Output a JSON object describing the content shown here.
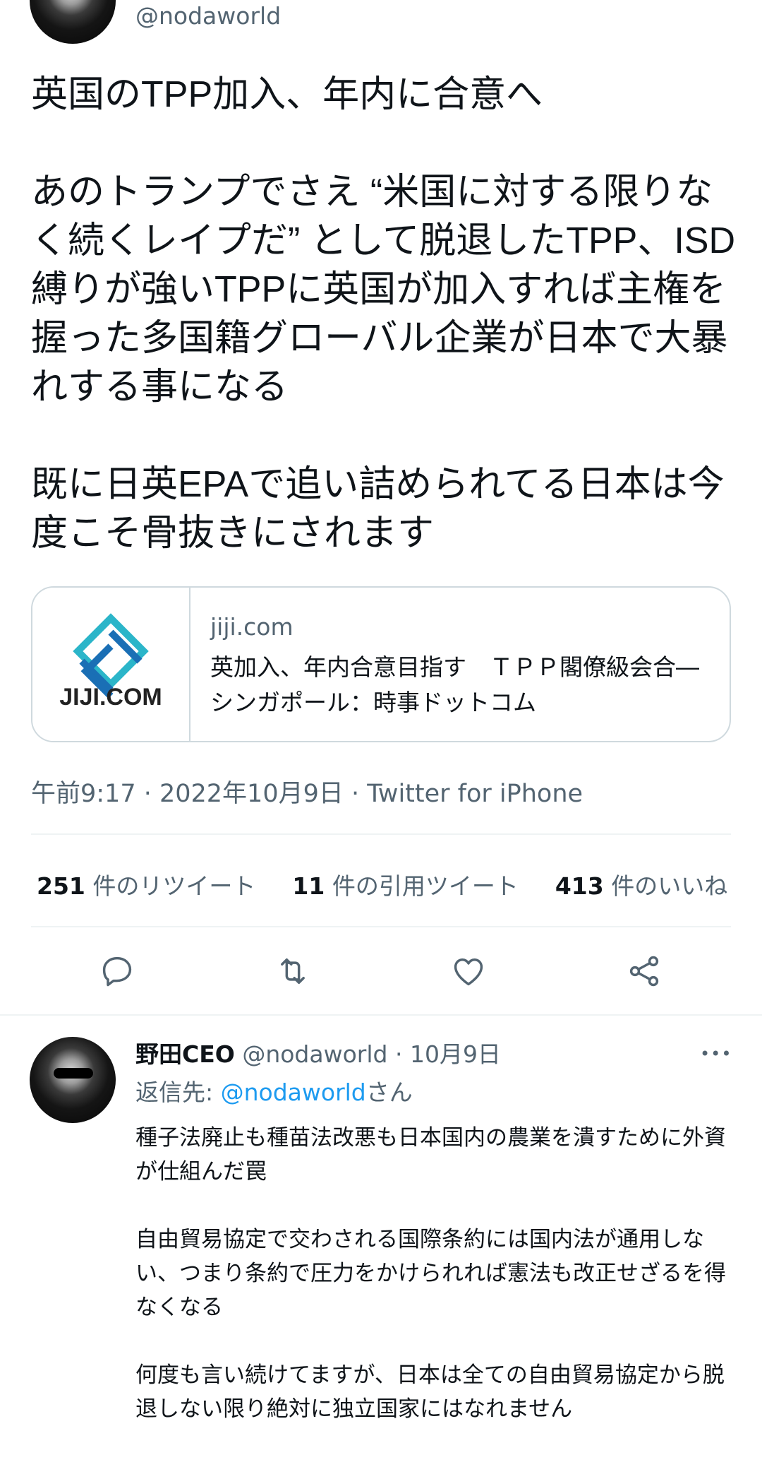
{
  "top_tweet": {
    "handle": "@nodaworld",
    "text": "英国のTPP加入、年内に合意へ\n\nあのトランプでさえ “米国に対する限りなく続くレイプだ” として脱退したTPP、ISD縛りが強いTPPに英国が加入すれば主権を握った多国籍グローバル企業が日本で大暴れする事になる\n\n既に日英EPAで追い詰められてる日本は今度こそ骨抜きにされます",
    "link_card": {
      "logo_text": "JIJI.COM",
      "domain": "jiji.com",
      "title": "英加入、年内合意目指す　ＴＰＰ閣僚級会合―シンガポール：時事ドットコム"
    },
    "meta": "午前9:17 · 2022年10月9日 · Twitter for iPhone",
    "stats": {
      "retweets": {
        "count": "251",
        "label": "件のリツイート"
      },
      "quotes": {
        "count": "11",
        "label": "件の引用ツイート"
      },
      "likes": {
        "count": "413",
        "label": "件のいいね"
      }
    },
    "actions": [
      "reply-icon",
      "retweet-icon",
      "like-icon",
      "share-icon"
    ]
  },
  "reply": {
    "name": "野田CEO",
    "handle": "@nodaworld",
    "date": "· 10月9日",
    "more": "•••",
    "replying_prefix": "返信先: ",
    "replying_handle": "@nodaworld",
    "replying_suffix": "さん",
    "text": "種子法廃止も種苗法改悪も日本国内の農業を潰すために外資が仕組んだ罠\n\n自由貿易協定で交わされる国際条約には国内法が通用しない、つまり条約で圧力をかけられれば憲法も改正せざるを得なくなる\n\n何度も言い続けてますが、日本は全ての自由貿易協定から脱退しない限り絶対に独立国家にはなれません"
  },
  "colors": {
    "text": "#0f1419",
    "secondary": "#536471",
    "link": "#1d9bf0",
    "border": "#cfd9de",
    "jiji_blue": "#1a6fb5",
    "jiji_teal": "#2bb5c9"
  }
}
